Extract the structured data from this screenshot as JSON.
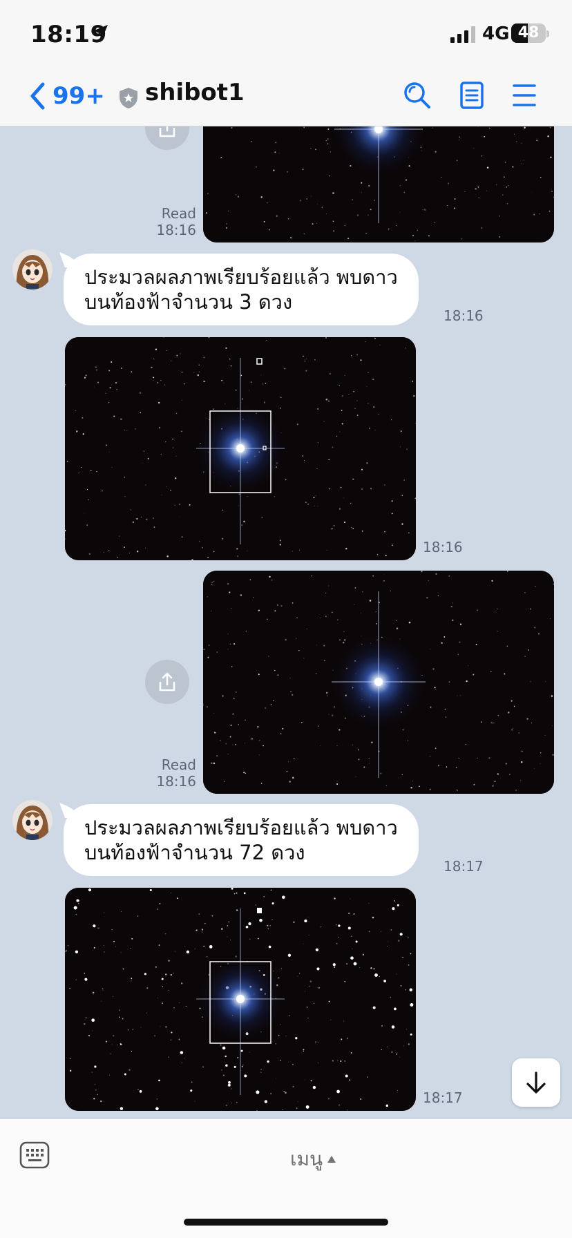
{
  "status_bar": {
    "time": "18:19",
    "network": "4G",
    "battery": "48",
    "battery_level": 0.48
  },
  "header": {
    "back_count": "99+",
    "title": "shibot1"
  },
  "messages": [
    {
      "type": "image",
      "side": "right",
      "read_label": "Read",
      "time": "18:16"
    },
    {
      "type": "text",
      "side": "left",
      "text_line1": "ประมวลผลภาพเรียบร้อยแล้ว พบดาว",
      "text_line2": "บนท้องฟ้าจำนวน 3 ดวง",
      "time": "18:16"
    },
    {
      "type": "image",
      "side": "left",
      "time": "18:16"
    },
    {
      "type": "image",
      "side": "right",
      "read_label": "Read",
      "time": "18:16"
    },
    {
      "type": "text",
      "side": "left",
      "text_line1": "ประมวลผลภาพเรียบร้อยแล้ว พบดาว",
      "text_line2": "บนท้องฟ้าจำนวน 72 ดวง",
      "time": "18:17"
    },
    {
      "type": "image",
      "side": "left",
      "time": "18:17"
    }
  ],
  "bottom_bar": {
    "menu_label": "เมนู"
  },
  "colors": {
    "accent": "#1a73e8",
    "chat_bg": "#cfd9e6"
  }
}
